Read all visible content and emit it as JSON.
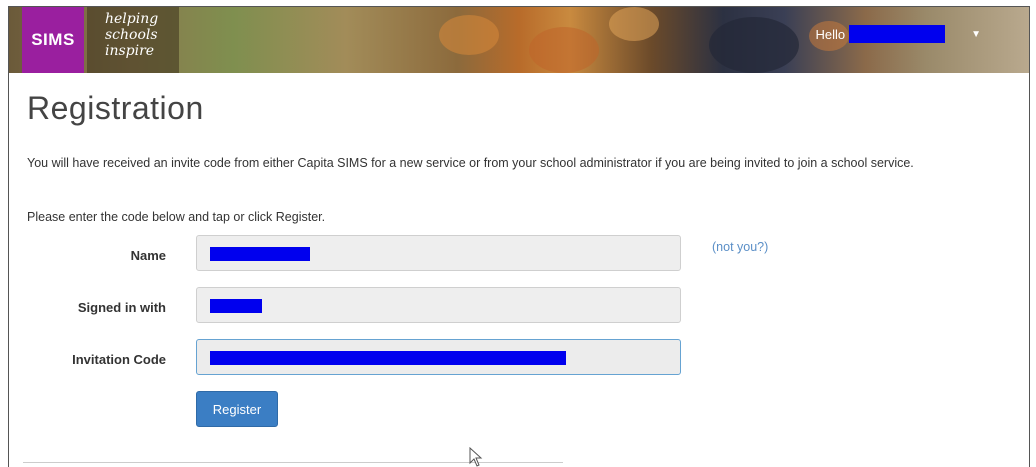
{
  "header": {
    "logo": "SIMS",
    "tagline_lines": [
      "helping",
      "schools",
      "inspire"
    ],
    "greeting": "Hello"
  },
  "page": {
    "title": "Registration",
    "intro": "You will have received an invite code from either Capita SIMS for a new service or from your school administrator if you are being invited to join a school service.",
    "instruction": "Please enter the code below and tap or click Register."
  },
  "form": {
    "name_label": "Name",
    "signed_in_label": "Signed in with",
    "invitation_label": "Invitation Code",
    "not_you": "(not you?)",
    "register_label": "Register"
  },
  "colors": {
    "logo_bg": "#9a1f9f",
    "redaction": "#0000ee",
    "button": "#3b7ec4",
    "link": "#5b8fc7"
  }
}
